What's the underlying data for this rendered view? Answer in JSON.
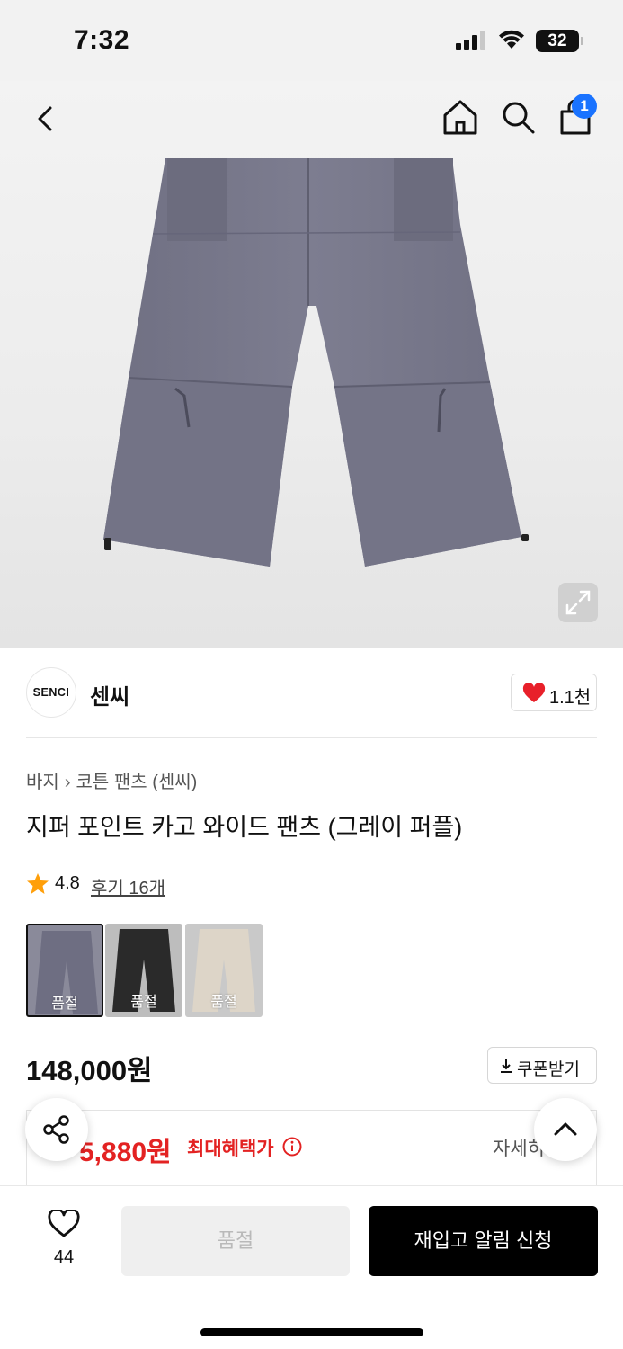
{
  "status_bar": {
    "time": "7:32",
    "battery": "32"
  },
  "nav": {
    "back_icon": "chevron-left-icon",
    "home_icon": "home-icon",
    "search_icon": "search-icon",
    "cart_icon": "shopping-bag-icon",
    "cart_count": "1"
  },
  "hero": {
    "product_color": "#7a7a8c",
    "expand_icon": "expand-icon"
  },
  "brand": {
    "logo_text": "SENCI",
    "name": "센씨",
    "like_count": "1.1천"
  },
  "breadcrumb": {
    "category": "바지",
    "subcategory": "코튼 팬츠 (센씨)"
  },
  "product": {
    "title": "지퍼 포인트 카고 와이드 팬츠 (그레이 퍼플)",
    "rating": "4.8",
    "reviews": "후기 16개",
    "price": "148,000원"
  },
  "color_options": [
    {
      "label": "품절",
      "color": "#7a7a8c",
      "selected": true
    },
    {
      "label": "품절",
      "color": "#2a2a2a",
      "selected": false
    },
    {
      "label": "품절",
      "color": "#d8d0c4",
      "selected": false
    }
  ],
  "coupon": {
    "label": "쿠폰받기"
  },
  "benefit": {
    "price": "5,880원",
    "label": "최대혜택가",
    "more": "자세히"
  },
  "bottom_bar": {
    "wish_count": "44",
    "soldout_label": "품절",
    "restock_label": "재입고 알림 신청"
  },
  "colors": {
    "accent_blue": "#1a73ff",
    "heart_red": "#e8202a",
    "sale_red": "#e32222",
    "star": "#ff9f0a"
  }
}
